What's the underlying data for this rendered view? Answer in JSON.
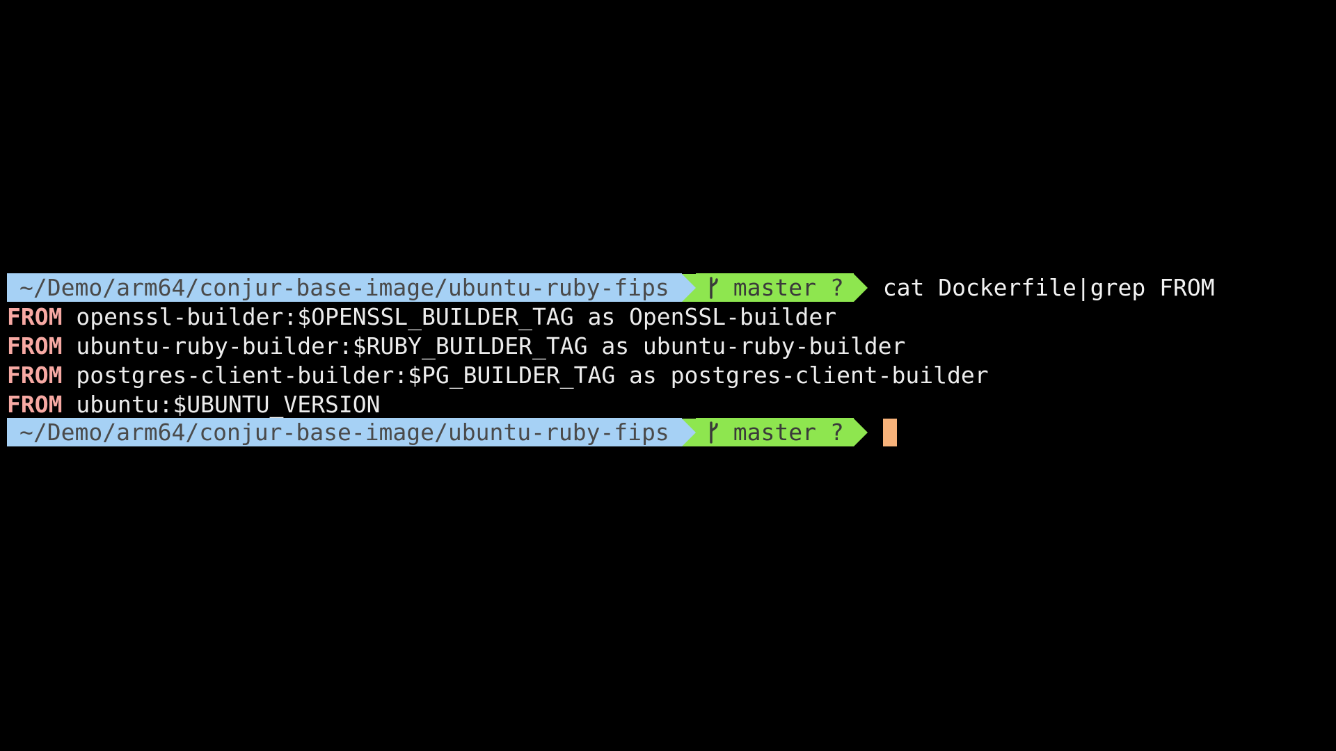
{
  "prompt": {
    "path": "~/Demo/arm64/conjur-base-image/ubuntu-ruby-fips",
    "branch": "master ?",
    "branch_icon": "git-branch-icon"
  },
  "command": "cat Dockerfile|grep FROM",
  "output": [
    {
      "keyword": "FROM",
      "text": " openssl-builder:$OPENSSL_BUILDER_TAG as OpenSSL-builder"
    },
    {
      "keyword": "FROM",
      "text": " ubuntu-ruby-builder:$RUBY_BUILDER_TAG as ubuntu-ruby-builder"
    },
    {
      "keyword": "FROM",
      "text": " postgres-client-builder:$PG_BUILDER_TAG as postgres-client-builder"
    },
    {
      "keyword": "FROM",
      "text": " ubuntu:$UBUNTU_VERSION"
    }
  ],
  "colors": {
    "background": "#000000",
    "path_segment": "#a6d1f5",
    "git_segment": "#8ee64f",
    "keyword": "#f7a9a3",
    "cursor": "#f7b27a"
  }
}
